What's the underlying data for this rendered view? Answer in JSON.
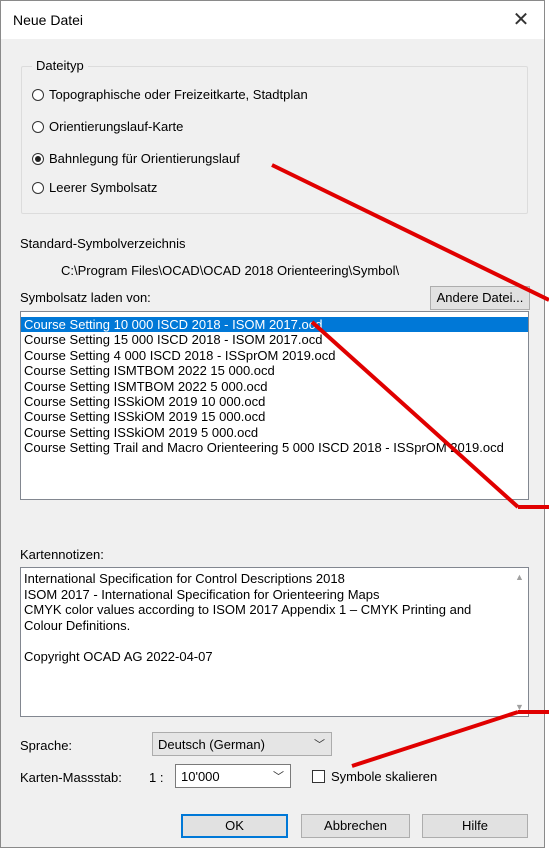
{
  "window": {
    "title": "Neue Datei",
    "close_glyph": "✕"
  },
  "filetype": {
    "label": "Dateityp",
    "options": [
      {
        "label": "Topographische oder Freizeitkarte, Stadtplan",
        "checked": false
      },
      {
        "label": "Orientierungslauf-Karte",
        "checked": false
      },
      {
        "label": "Bahnlegung für Orientierungslauf",
        "checked": true
      },
      {
        "label": "Leerer Symbolsatz",
        "checked": false
      }
    ]
  },
  "symbol_dir": {
    "label": "Standard-Symbolverzeichnis",
    "path": "C:\\Program Files\\OCAD\\OCAD 2018 Orienteering\\Symbol\\"
  },
  "symbolset": {
    "label": "Symbolsatz laden von:",
    "other_file_button": "Andere Datei...",
    "items": [
      "Course Setting 10 000 ISCD 2018 - ISOM 2017.ocd",
      "Course Setting 15 000 ISCD 2018 - ISOM 2017.ocd",
      "Course Setting 4 000 ISCD 2018 - ISSprOM 2019.ocd",
      "Course Setting ISMTBOM 2022 15 000.ocd",
      "Course Setting ISMTBOM 2022 5 000.ocd",
      "Course Setting ISSkiOM 2019 10 000.ocd",
      "Course Setting ISSkiOM 2019 15 000.ocd",
      "Course Setting ISSkiOM 2019 5 000.ocd",
      "Course Setting Trail and Macro Orienteering 5 000 ISCD 2018 - ISSprOM 2019.ocd"
    ],
    "selected_index": 0
  },
  "notes": {
    "label": "Kartennotizen:",
    "lines": [
      "International Specification for Control Descriptions 2018",
      "ISOM 2017 - International Specification for Orienteering Maps",
      "CMYK color values according to ISOM 2017 Appendix 1 – CMYK Printing and",
      "Colour Definitions.",
      "",
      "Copyright OCAD AG 2022-04-07"
    ]
  },
  "language": {
    "label": "Sprache:",
    "value": "Deutsch (German)"
  },
  "scale": {
    "label": "Karten-Massstab:",
    "prefix": "1 :",
    "value": "10'000",
    "checkbox_label": "Symbole skalieren",
    "checkbox_checked": false
  },
  "buttons": {
    "ok": "OK",
    "cancel": "Abbrechen",
    "help": "Hilfe"
  },
  "colors": {
    "accent": "#0078d7",
    "annotation_arrow": "#e00000",
    "dialog_bg": "#f0f0f0"
  }
}
